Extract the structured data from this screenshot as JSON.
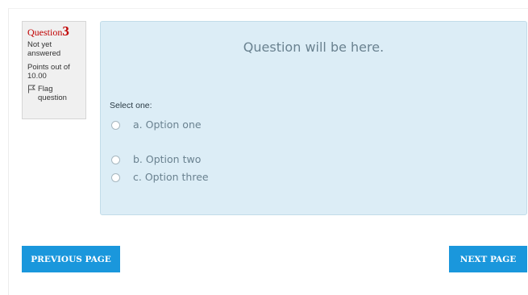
{
  "question_info": {
    "label": "Question",
    "number": "3",
    "state": "Not yet answered",
    "grade": "Points out of 10.00",
    "flag_label": "Flag question"
  },
  "question": {
    "text": "Question will be here.",
    "prompt": "Select one:",
    "answers": [
      {
        "label": "a. Option one",
        "selected": false
      },
      {
        "label": "b. Option two",
        "selected": false
      },
      {
        "label": "c. Option three",
        "selected": false
      }
    ]
  },
  "navigation": {
    "previous_label": "PREVIOUS PAGE",
    "next_label": "NEXT PAGE"
  },
  "colors": {
    "accent": "#1a97dc",
    "question_number": "#c00000",
    "content_bg": "#dcedf6"
  },
  "icons": {
    "flag": "flag-outline-icon",
    "radio": "radio-unchecked-icon"
  }
}
